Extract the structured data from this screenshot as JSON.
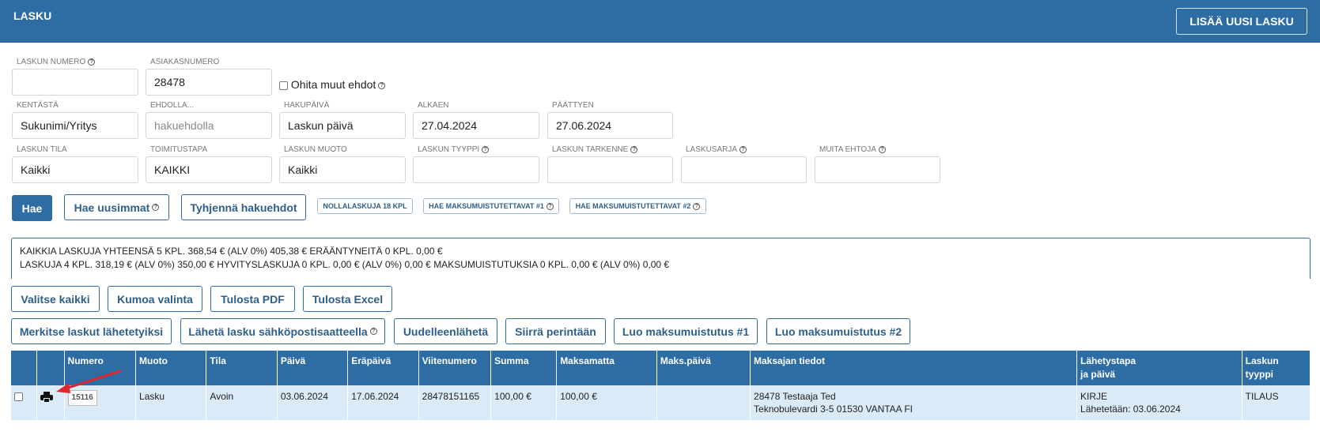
{
  "header": {
    "title": "LASKU",
    "new_invoice_button": "LISÄÄ UUSI LASKU",
    "color": "#2e6da4"
  },
  "filters": {
    "laskun_numero": {
      "label": "LASKUN NUMERO",
      "value": ""
    },
    "asiakasnumero": {
      "label": "ASIAKASNUMERO",
      "value": "28478"
    },
    "ohita": {
      "label": "Ohita muut ehdot",
      "checked": false
    },
    "kentasta": {
      "label": "KENTÄSTÄ",
      "value": "Sukunimi/Yritys"
    },
    "ehdolla": {
      "label": "EHDOLLA...",
      "placeholder": "hakuehdolla"
    },
    "hakupaiva": {
      "label": "HAKUPÄIVÄ",
      "value": "Laskun päivä"
    },
    "alkaen": {
      "label": "ALKAEN",
      "value": "27.04.2024"
    },
    "paattyen": {
      "label": "PÄÄTTYEN",
      "value": "27.06.2024"
    },
    "laskun_tila": {
      "label": "LASKUN TILA",
      "value": "Kaikki"
    },
    "toimitustapa": {
      "label": "TOIMITUSTAPA",
      "value": "KAIKKI"
    },
    "laskun_muoto": {
      "label": "LASKUN MUOTO",
      "value": "Kaikki"
    },
    "laskun_tyyppi": {
      "label": "LASKUN TYYPPI",
      "value": ""
    },
    "laskun_tarkenne": {
      "label": "LASKUN TARKENNE",
      "value": ""
    },
    "laskusarja": {
      "label": "LASKUSARJA",
      "value": ""
    },
    "muita_ehtoja": {
      "label": "MUITA EHTOJA",
      "value": ""
    }
  },
  "search_buttons": {
    "hae": "Hae",
    "hae_uusimmat": "Hae uusimmat",
    "tyhjenna": "Tyhjennä hakuehdot",
    "nollalaskuja": "NOLLALASKUJA 18 KPL",
    "maksumuistutettavat1": "HAE MAKSUMUISTUTETTAVAT #1",
    "maksumuistutettavat2": "HAE MAKSUMUISTUTETTAVAT #2"
  },
  "summary": {
    "line1": "KAIKKIA LASKUJA YHTEENSÄ 5 KPL. 368,54 € (ALV 0%)  405,38 € ERÄÄNTYNEITÄ 0 KPL. 0,00 €",
    "line2": "LASKUJA 4 KPL. 318,19 € (ALV 0%)  350,00 €   HYVITYSLASKUJA 0 KPL. 0,00 € (ALV 0%)  0,00 €   MAKSUMUISTUTUKSIA 0 KPL. 0,00 € (ALV 0%)  0,00 €"
  },
  "actions": {
    "valitse_kaikki": "Valitse kaikki",
    "kumoa_valinta": "Kumoa valinta",
    "tulosta_pdf": "Tulosta PDF",
    "tulosta_excel": "Tulosta Excel",
    "merkitse": "Merkitse laskut lähetetyiksi",
    "laheta": "Lähetä lasku sähköpostisaatteella",
    "uudelleenlaheta": "Uudelleenlähetä",
    "siirra": "Siirrä perintään",
    "luo1": "Luo maksumuistutus #1",
    "luo2": "Luo maksumuistutus #2"
  },
  "table": {
    "headers": {
      "numero": "Numero",
      "muoto": "Muoto",
      "tila": "Tila",
      "paiva": "Päivä",
      "erapaiva": "Eräpäivä",
      "viitenumero": "Viitenumero",
      "summa": "Summa",
      "maksamatta": "Maksamatta",
      "maks_paiva": "Maks.päivä",
      "maksajan_tiedot": "Maksajan tiedot",
      "lahetystapa_1": "Lähetystapa",
      "lahetystapa_2": "ja päivä",
      "laskun_tyyppi_1": "Laskun",
      "laskun_tyyppi_2": "tyyppi"
    },
    "rows": [
      {
        "numero": "15116",
        "muoto": "Lasku",
        "tila": "Avoin",
        "paiva": "03.06.2024",
        "erapaiva": "17.06.2024",
        "viitenumero": "28478151165",
        "summa": "100,00 €",
        "maksamatta": "100,00 €",
        "maks_paiva": "",
        "maksaja_1": "28478 Testaaja Ted",
        "maksaja_2": "Teknobulevardi 3-5 01530 VANTAA FI",
        "lahetystapa": "KIRJE",
        "lahetetaan": "Lähetetään: 03.06.2024",
        "tyyppi": "TILAUS"
      }
    ]
  },
  "annotation": {
    "arrow_color": "#e0262c",
    "icon": "printer-icon"
  }
}
